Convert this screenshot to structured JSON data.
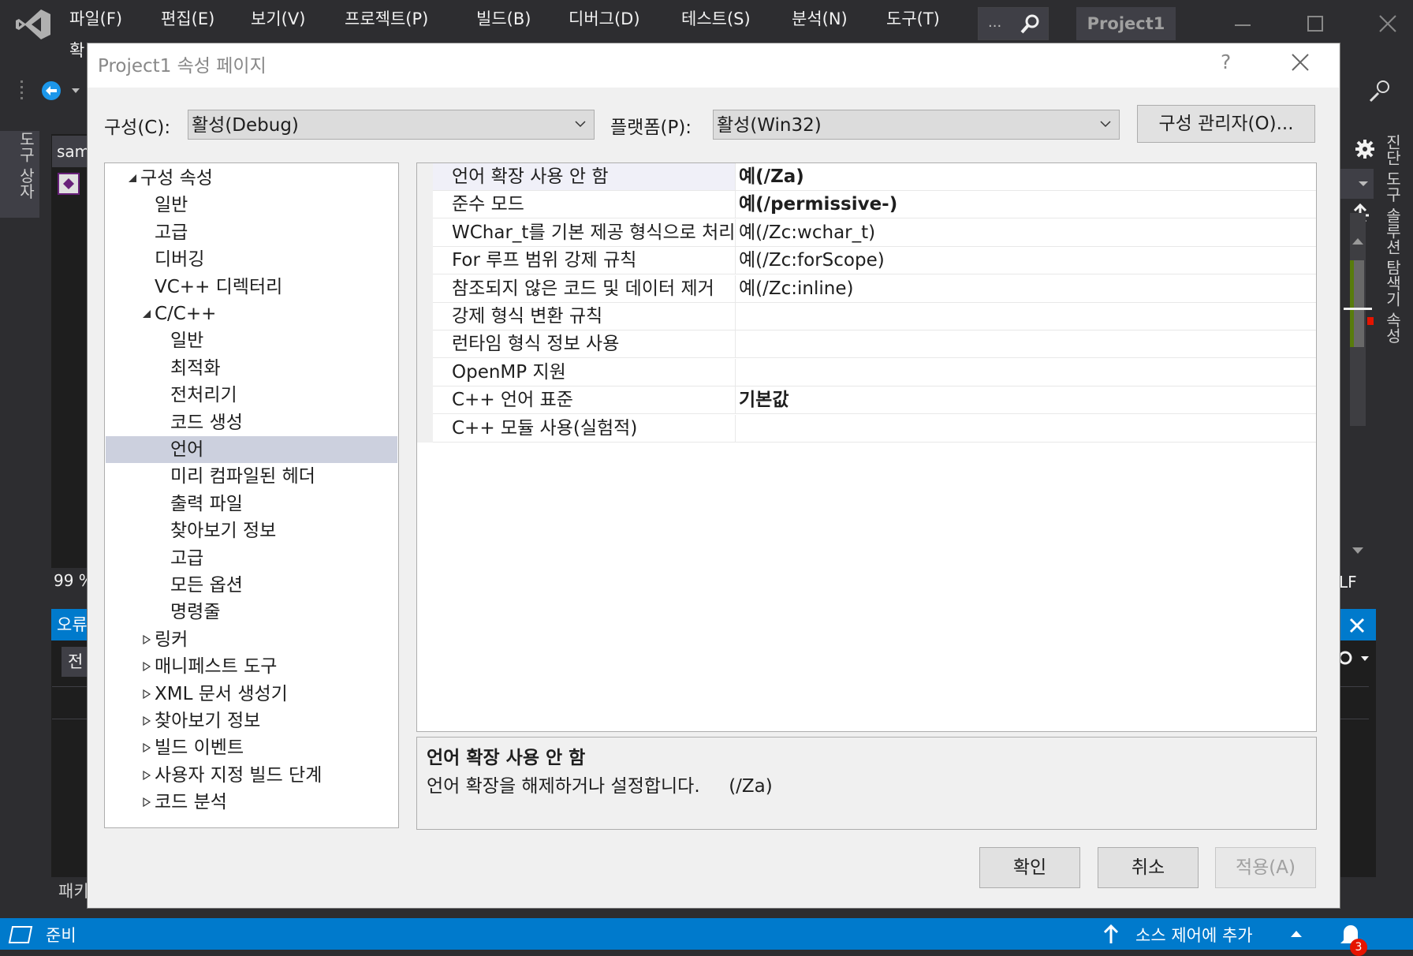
{
  "menu": [
    "파일(F)",
    "편집(E)",
    "보기(V)",
    "프로젝트(P)",
    "빌드(B)",
    "디버그(D)",
    "테스트(S)",
    "분석(N)",
    "도구(T)"
  ],
  "search_dots": "...",
  "project_tab": "Project1",
  "bg": {
    "menu_second_line": "확",
    "left_vertical": "도구 상자",
    "editor_tab": "sam",
    "zoom": "99 %",
    "error_panel_title": "오류",
    "error_filter": "전",
    "bottom_tab": "패키",
    "lf": "LF",
    "right_vertical": "진단 도구   솔루션 탐색기   속성"
  },
  "dialog": {
    "title": "Project1 속성 페이지",
    "help": "?",
    "config_label": "구성(C):",
    "config_value": "활성(Debug)",
    "platform_label": "플랫폼(P):",
    "platform_value": "활성(Win32)",
    "config_manager": "구성 관리자(O)...",
    "tree": [
      {
        "label": "구성 속성",
        "indent": 0,
        "expander": "open"
      },
      {
        "label": "일반",
        "indent": 1
      },
      {
        "label": "고급",
        "indent": 1
      },
      {
        "label": "디버깅",
        "indent": 1
      },
      {
        "label": "VC++ 디렉터리",
        "indent": 1
      },
      {
        "label": "C/C++",
        "indent": 1,
        "expander": "open"
      },
      {
        "label": "일반",
        "indent": 2
      },
      {
        "label": "최적화",
        "indent": 2
      },
      {
        "label": "전처리기",
        "indent": 2
      },
      {
        "label": "코드 생성",
        "indent": 2
      },
      {
        "label": "언어",
        "indent": 2,
        "selected": true
      },
      {
        "label": "미리 컴파일된 헤더",
        "indent": 2
      },
      {
        "label": "출력 파일",
        "indent": 2
      },
      {
        "label": "찾아보기 정보",
        "indent": 2
      },
      {
        "label": "고급",
        "indent": 2
      },
      {
        "label": "모든 옵션",
        "indent": 2
      },
      {
        "label": "명령줄",
        "indent": 2
      },
      {
        "label": "링커",
        "indent": 1,
        "expander": "closed"
      },
      {
        "label": "매니페스트 도구",
        "indent": 1,
        "expander": "closed"
      },
      {
        "label": "XML 문서 생성기",
        "indent": 1,
        "expander": "closed"
      },
      {
        "label": "찾아보기 정보",
        "indent": 1,
        "expander": "closed"
      },
      {
        "label": "빌드 이벤트",
        "indent": 1,
        "expander": "closed"
      },
      {
        "label": "사용자 지정 빌드 단계",
        "indent": 1,
        "expander": "closed"
      },
      {
        "label": "코드 분석",
        "indent": 1,
        "expander": "closed"
      }
    ],
    "properties": [
      {
        "name": "언어 확장 사용 안 함",
        "value": "예(/Za)",
        "bold": true
      },
      {
        "name": "준수 모드",
        "value": "예(/permissive-)",
        "bold": true
      },
      {
        "name": "WChar_t를 기본 제공 형식으로 처리",
        "value": "예(/Zc:wchar_t)",
        "bold": false
      },
      {
        "name": "For 루프 범위 강제 규칙",
        "value": "예(/Zc:forScope)",
        "bold": false
      },
      {
        "name": "참조되지 않은 코드 및 데이터 제거",
        "value": "예(/Zc:inline)",
        "bold": false
      },
      {
        "name": "강제 형식 변환 규칙",
        "value": "",
        "bold": false
      },
      {
        "name": "런타임 형식 정보 사용",
        "value": "",
        "bold": false
      },
      {
        "name": "OpenMP 지원",
        "value": "",
        "bold": false
      },
      {
        "name": "C++ 언어 표준",
        "value": "기본값",
        "bold": true
      },
      {
        "name": "C++ 모듈 사용(실험적)",
        "value": "",
        "bold": false
      }
    ],
    "desc_title": "언어 확장 사용 안 함",
    "desc_text": "언어 확장을 해제하거나 설정합니다.     (/Za)",
    "ok": "확인",
    "cancel": "취소",
    "apply": "적용(A)"
  },
  "status": {
    "ready": "준비",
    "source_control": "소스 제어에 추가",
    "notifications": "3"
  },
  "colors": {
    "accent": "#007acc",
    "vs_purple": "#68217a"
  }
}
